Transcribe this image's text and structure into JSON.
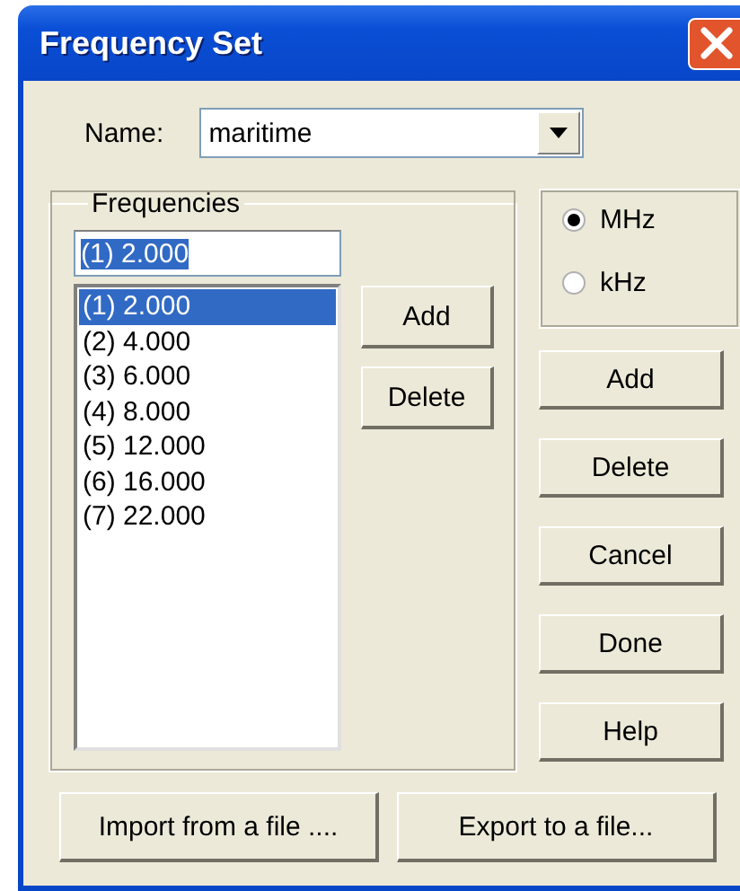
{
  "window": {
    "title": "Frequency Set"
  },
  "name": {
    "label": "Name:",
    "value": "maritime"
  },
  "frequencies": {
    "title": "Frequencies",
    "entry": {
      "value": "(1) 2.000",
      "text_selected": true
    },
    "items": [
      {
        "label": "(1) 2.000",
        "selected": true
      },
      {
        "label": "(2) 4.000",
        "selected": false
      },
      {
        "label": "(3) 6.000",
        "selected": false
      },
      {
        "label": "(4) 8.000",
        "selected": false
      },
      {
        "label": "(5) 12.000",
        "selected": false
      },
      {
        "label": "(6) 16.000",
        "selected": false
      },
      {
        "label": "(7) 22.000",
        "selected": false
      }
    ],
    "buttons": [
      "Add",
      "Delete"
    ]
  },
  "units": [
    {
      "label": "MHz",
      "selected": true
    },
    {
      "label": "kHz",
      "selected": false
    }
  ],
  "buttons": [
    "Add",
    "Delete",
    "Cancel",
    "Done",
    "Help"
  ],
  "file_buttons": [
    "Import from a file ....",
    "Export to a file..."
  ]
}
